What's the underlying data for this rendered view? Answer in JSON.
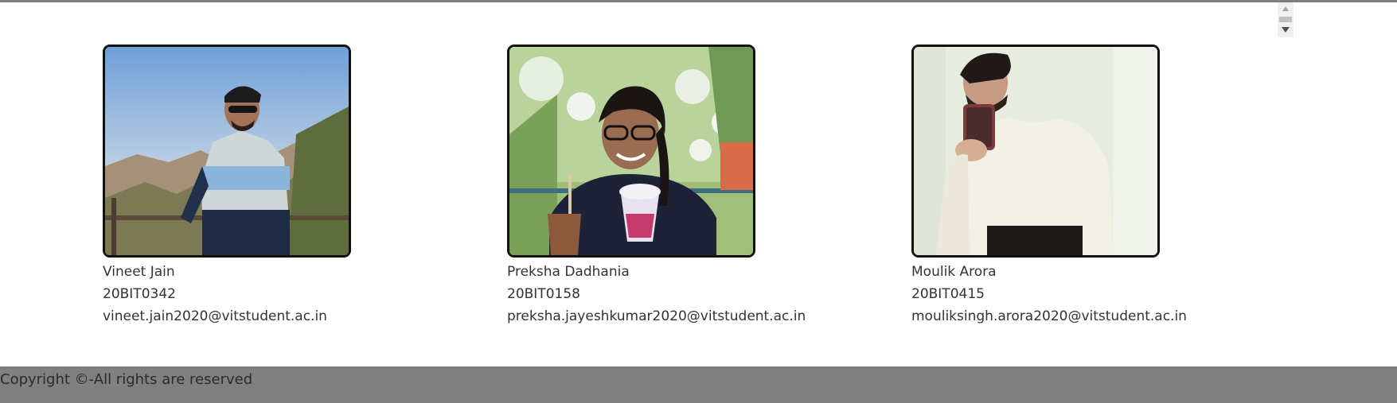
{
  "members": [
    {
      "name": "Vineet Jain",
      "id": "20BIT0342",
      "email": "vineet.jain2020@vitstudent.ac.in"
    },
    {
      "name": "Preksha Dadhania",
      "id": "20BIT0158",
      "email": "preksha.jayeshkumar2020@vitstudent.ac.in"
    },
    {
      "name": "Moulik Arora",
      "id": "20BIT0415",
      "email": "mouliksingh.arora2020@vitstudent.ac.in"
    }
  ],
  "footer": {
    "copyright": "Copyright ©-All rights are reserved"
  }
}
